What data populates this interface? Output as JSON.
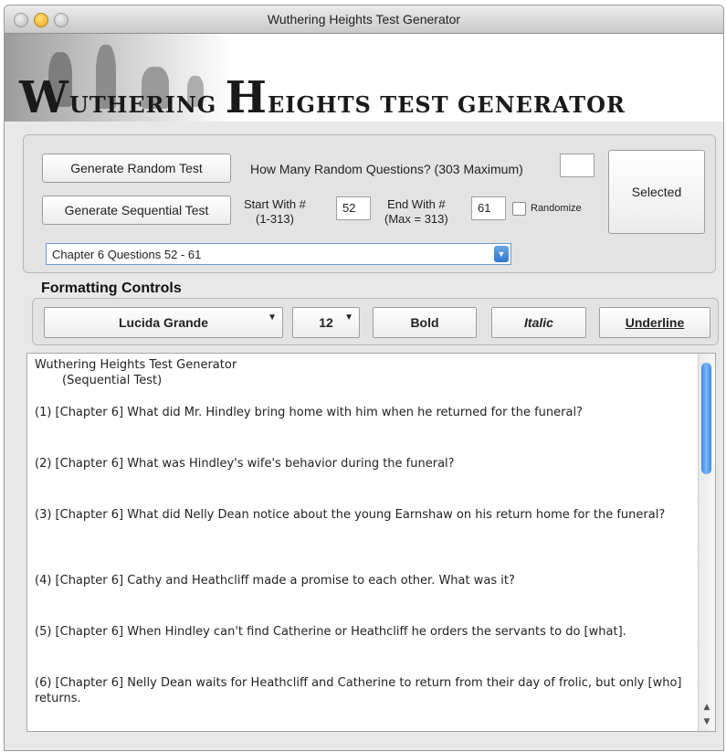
{
  "window": {
    "title": "Wuthering Heights Test Generator"
  },
  "banner": {
    "w": "W",
    "uthering": "UTHERING",
    "h": "H",
    "eights": "EIGHTS TEST GENERATOR"
  },
  "generator": {
    "random_button": "Generate Random Test",
    "random_label": "How Many Random Questions? (303 Maximum)",
    "random_value": "",
    "sequential_button": "Generate Sequential Test",
    "start_label_1": "Start With #",
    "start_label_2": "(1-313)",
    "start_value": "52",
    "end_label_1": "End With #",
    "end_label_2": "(Max = 313)",
    "end_value": "61",
    "randomize_label": "Randomize",
    "selected_label": "Selected",
    "chapter_select": "Chapter 6  Questions 52 - 61"
  },
  "formatting": {
    "title": "Formatting Controls",
    "font": "Lucida Grande",
    "size": "12",
    "bold": "Bold",
    "italic": "Italic",
    "underline": "Underline"
  },
  "output": {
    "header": "Wuthering Heights Test Generator",
    "subheader": "(Sequential Test)",
    "questions": [
      "(1)  [Chapter 6]  What did Mr. Hindley bring home with him when he returned for the funeral?",
      "(2)  [Chapter 6]  What was Hindley's wife's behavior during the funeral?",
      "(3)  [Chapter 6]  What did Nelly Dean notice about the young Earnshaw on his return home for the funeral?",
      "(4)  [Chapter 6]  Cathy and Heathcliff made a promise to each other.  What was it?",
      "(5)  [Chapter 6]  When Hindley can't find Catherine or Heathcliff he orders the servants to do [what].",
      "(6)  [Chapter 6]  Nelly Dean waits for Heathcliff and Catherine to return from their day of frolic, but only [who] returns."
    ]
  },
  "icons": {
    "dropdown": "chevron-down-icon",
    "scroll_up": "arrow-up-icon",
    "scroll_down": "arrow-down-icon"
  },
  "colors": {
    "accent": "#3f88e4",
    "window_bg": "#e8e8e8"
  }
}
